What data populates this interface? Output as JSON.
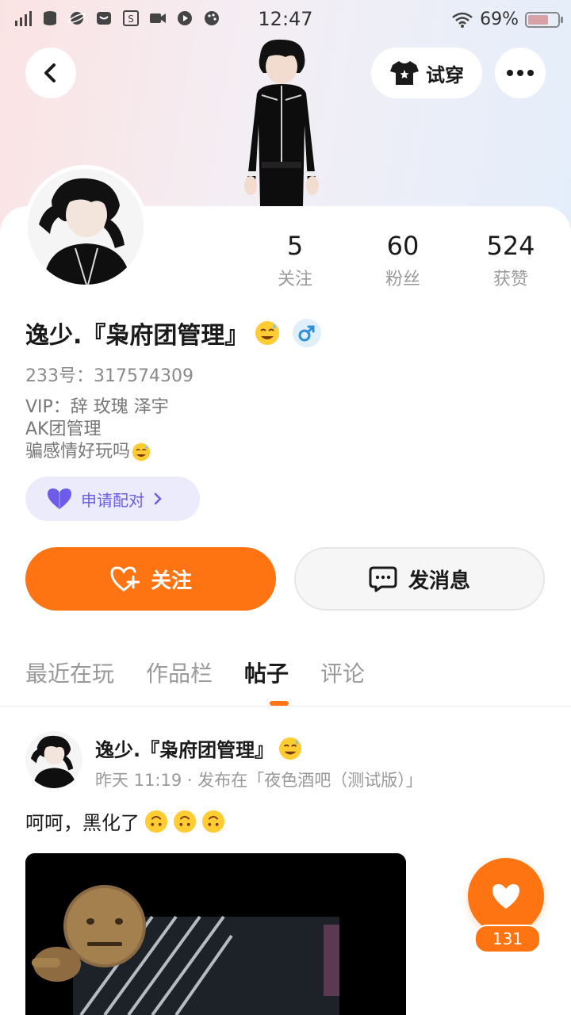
{
  "status_bar": {
    "time": "12:47",
    "battery_percent": "69%",
    "battery_level": 0.69
  },
  "header": {
    "tryon_label": "试穿"
  },
  "profile": {
    "stats": [
      {
        "value": "5",
        "label": "关注"
      },
      {
        "value": "60",
        "label": "粉丝"
      },
      {
        "value": "524",
        "label": "获赞"
      }
    ],
    "name": "逸少.『枭府团管理』",
    "id_label": "233号：",
    "id_value": "317574309",
    "bio_lines": [
      "VIP：辞 玫瑰 泽宇",
      "AK团管理",
      "骗感情好玩吗"
    ],
    "match_label": "申请配对"
  },
  "actions": {
    "follow_label": "关注",
    "message_label": "发消息"
  },
  "tabs": [
    {
      "label": "最近在玩",
      "active": false
    },
    {
      "label": "作品栏",
      "active": false
    },
    {
      "label": "帖子",
      "active": true
    },
    {
      "label": "评论",
      "active": false
    }
  ],
  "post": {
    "author": "逸少.『枭府团管理』",
    "meta": "昨天 11:19 · 发布在「夜色酒吧（测试版）」",
    "text": "呵呵，黑化了",
    "like_count": "131"
  },
  "icons": {
    "back": "chevron-left-icon",
    "tryon": "tshirt-icon",
    "more": "more-dots-icon",
    "gender": "male-icon",
    "match": "heart-icon",
    "follow": "heart-plus-icon",
    "message": "chat-bubble-icon",
    "like": "heart-icon"
  },
  "colors": {
    "accent": "#ff7412",
    "match_pill_bg": "#ecebfb",
    "match_pill_text": "#6c5ce7",
    "gender_blue": "#2f8fd8"
  }
}
